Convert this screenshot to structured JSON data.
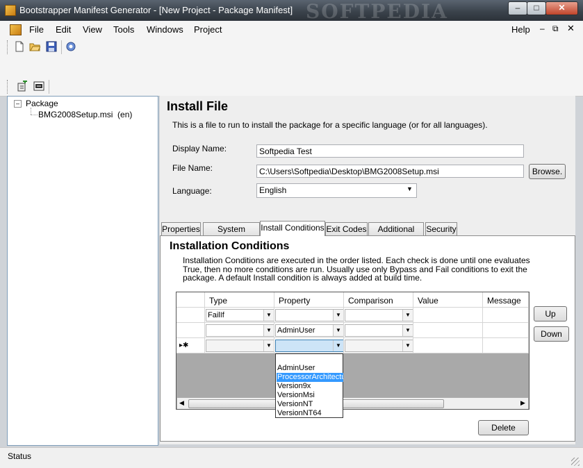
{
  "window": {
    "title": "Bootstrapper Manifest Generator - [New Project - Package Manifest]",
    "watermark": "SOFTPEDIA"
  },
  "menubar": {
    "items": [
      "File",
      "Edit",
      "View",
      "Tools",
      "Windows",
      "Project"
    ],
    "help": "Help"
  },
  "tree": {
    "root": "Package",
    "child": "BMG2008Setup.msi  (en)"
  },
  "install_file": {
    "heading": "Install File",
    "description": "This is a file to run to install the package for a specific language (or for all languages).",
    "display_name_label": "Display Name:",
    "display_name_value": "Softpedia Test",
    "file_name_label": "File Name:",
    "file_name_value": "C:\\Users\\Softpedia\\Desktop\\BMG2008Setup.msi",
    "browse_label": "Browse.",
    "language_label": "Language:",
    "language_value": "English"
  },
  "tabs": [
    "Properties",
    "System Checks",
    "Install Conditions",
    "Exit Codes",
    "Additional Files",
    "Security"
  ],
  "conditions": {
    "heading": "Installation Conditions",
    "description_1": "Installation Conditions are executed in the order listed.  Each check is done until one evaluates",
    "description_2": "True, then no more conditions are run.  Usually use only Bypass and Fail conditions to exit the",
    "description_3": "package.  A default Install condition is always added at build time.",
    "columns": [
      "Type",
      "Property",
      "Comparison",
      "Value",
      "Message"
    ],
    "rows": [
      {
        "type": "FailIf",
        "property": "",
        "comparison": "",
        "value": "",
        "message": ""
      },
      {
        "type": "",
        "property": "AdminUser",
        "comparison": "",
        "value": "",
        "message": ""
      },
      {
        "type": "",
        "property": "",
        "comparison": "",
        "value": "",
        "message": ""
      }
    ],
    "new_row_marker": "▸✱",
    "dropdown_options": [
      "AdminUser",
      "ProcessorArchitecture",
      "Version9x",
      "VersionMsi",
      "VersionNT",
      "VersionNT64"
    ],
    "dropdown_selected": "ProcessorArchitecture",
    "up_label": "Up",
    "down_label": "Down",
    "delete_label": "Delete"
  },
  "status": {
    "text": "Status"
  }
}
